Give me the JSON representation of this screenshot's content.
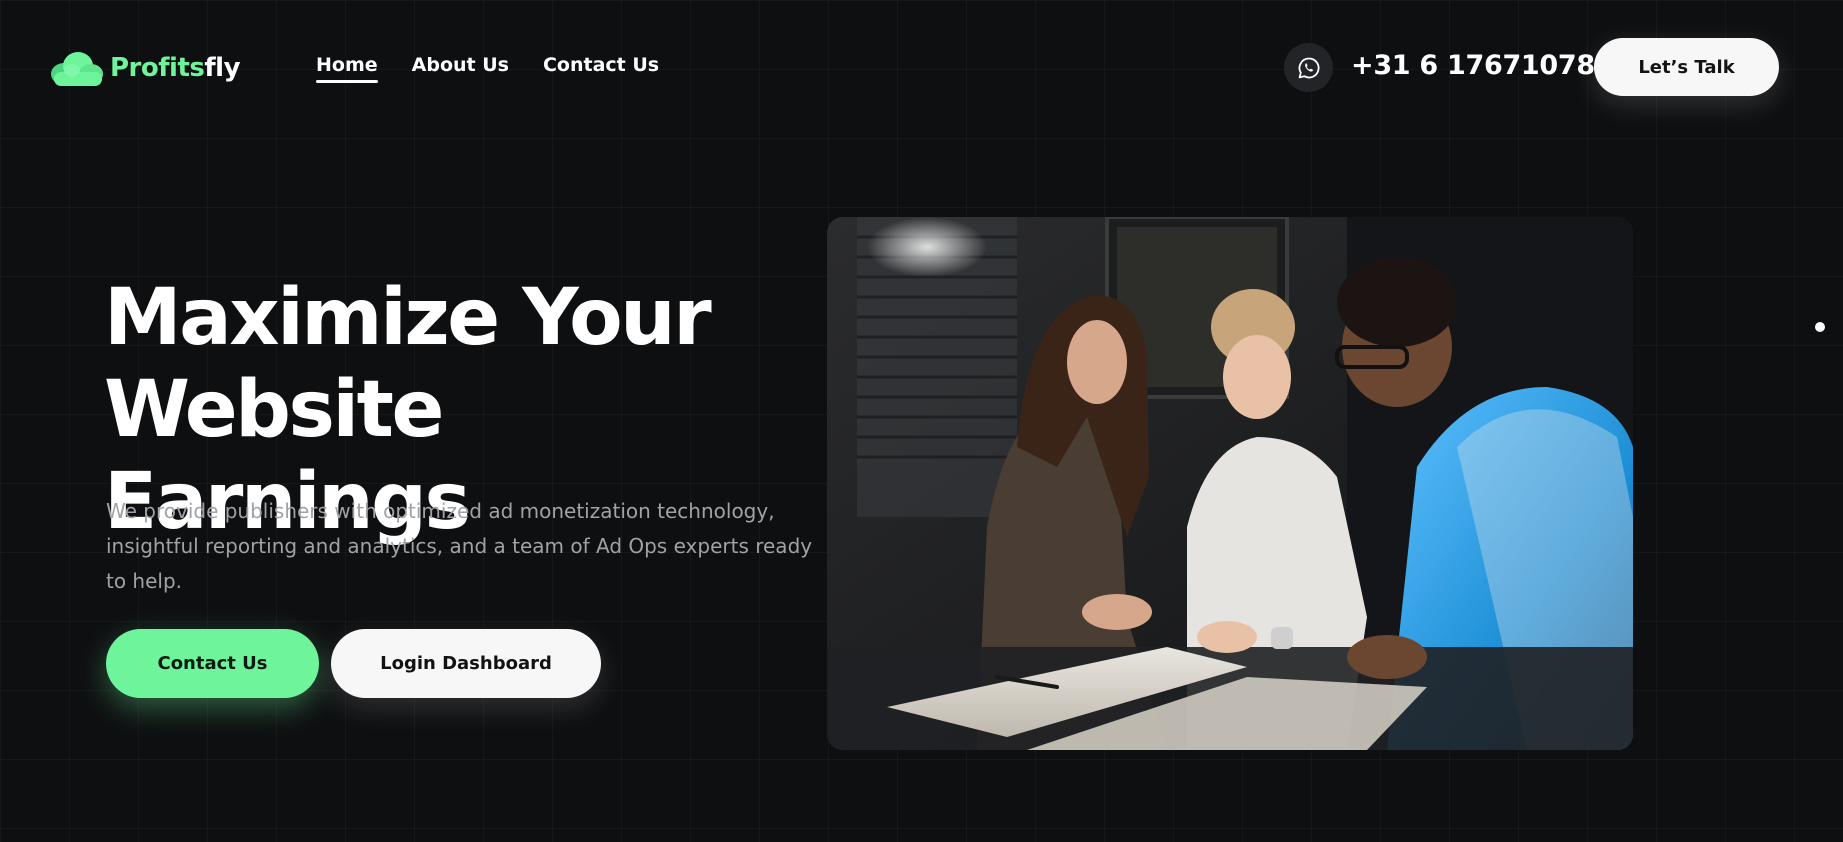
{
  "brand": {
    "logo_accent": "Profits",
    "logo_rest": "fly",
    "accent_color": "#6ef59b"
  },
  "nav": {
    "items": [
      {
        "label": "Home",
        "active": true
      },
      {
        "label": "About Us",
        "active": false
      },
      {
        "label": "Contact Us",
        "active": false
      }
    ]
  },
  "header": {
    "whatsapp_icon": "whatsapp-icon",
    "phone": "+31 6 17671078",
    "cta_label": "Let’s Talk"
  },
  "hero": {
    "title_line1": "Maximize Your",
    "title_line2": "Website Earnings",
    "description": "We provide publishers with optimized ad monetization technology, insightful reporting and analytics, and a team of Ad Ops experts ready to help.",
    "primary_button": "Contact Us",
    "secondary_button": "Login Dashboard",
    "image_icon": "team-meeting-photo"
  }
}
